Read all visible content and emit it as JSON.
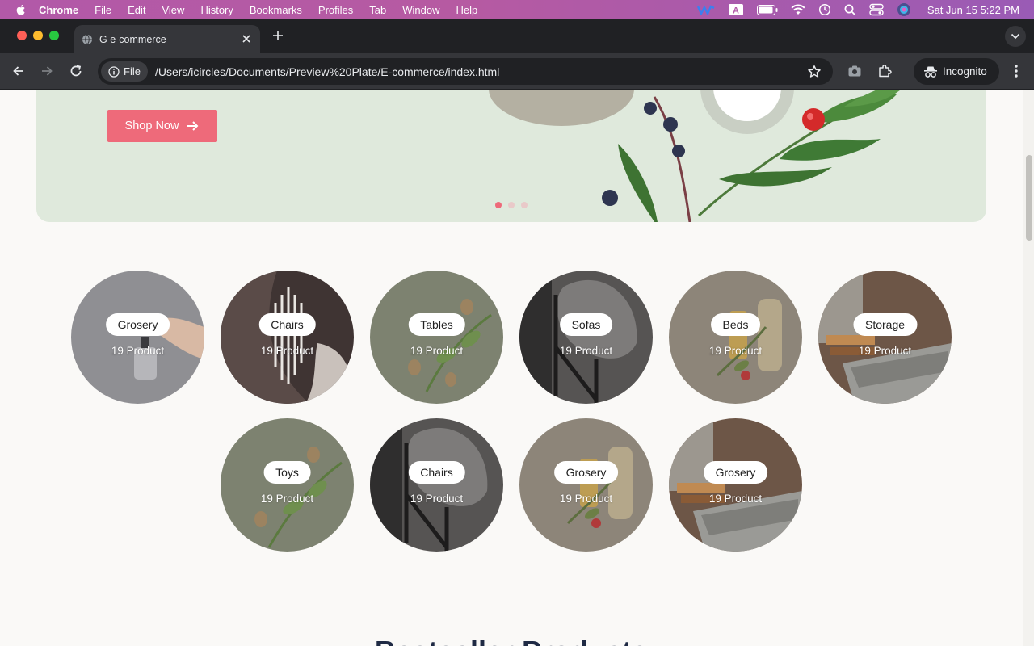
{
  "menubar": {
    "app_name": "Chrome",
    "items": [
      "File",
      "Edit",
      "View",
      "History",
      "Bookmarks",
      "Profiles",
      "Tab",
      "Window",
      "Help"
    ],
    "clock": "Sat Jun 15  5:22 PM"
  },
  "browser": {
    "tab_title": "G e-commerce",
    "url_chip": "File",
    "url": "/Users/icircles/Documents/Preview%20Plate/E-commerce/index.html",
    "profile_label": "Incognito"
  },
  "hero": {
    "cta_label": "Shop Now",
    "slide_count": 3,
    "active_slide": 1
  },
  "categories": [
    {
      "name": "Grosery",
      "count": "19 Product"
    },
    {
      "name": "Chairs",
      "count": "19 Product"
    },
    {
      "name": "Tables",
      "count": "19 Product"
    },
    {
      "name": "Sofas",
      "count": "19 Product"
    },
    {
      "name": "Beds",
      "count": "19 Product"
    },
    {
      "name": "Storage",
      "count": "19 Product"
    },
    {
      "name": "Toys",
      "count": "19 Product"
    },
    {
      "name": "Chairs",
      "count": "19 Product"
    },
    {
      "name": "Grosery",
      "count": "19 Product"
    },
    {
      "name": "Grosery",
      "count": "19 Product"
    }
  ],
  "section": {
    "title": "Bestseller Products"
  },
  "colors": {
    "accent": "#ee6a7a",
    "hero_bg": "#dfe9dc",
    "page_bg": "#faf9f7"
  }
}
